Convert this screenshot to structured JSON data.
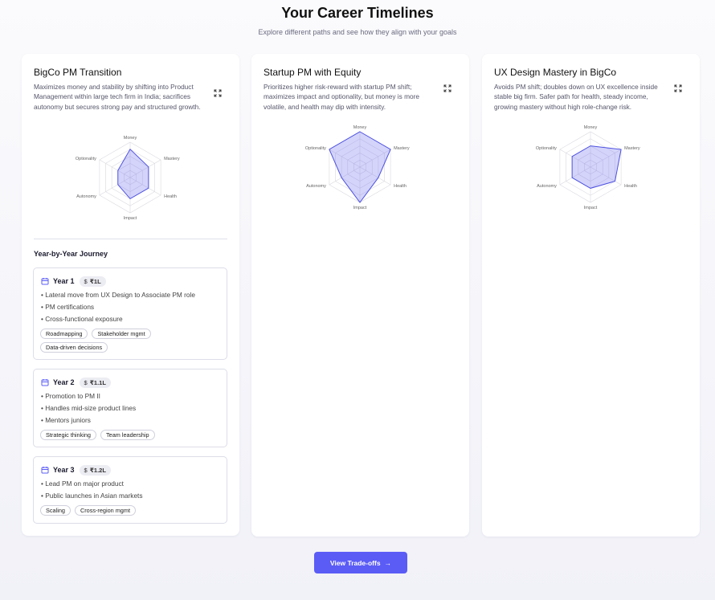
{
  "page": {
    "title": "Your Career Timelines",
    "subtitle": "Explore different paths and see how they align with your goals"
  },
  "radar_axes": [
    "Money",
    "Mastery",
    "Health",
    "Impact",
    "Autonomy",
    "Optionality"
  ],
  "radar_scale_max": 5,
  "colors": {
    "accent": "#5b5cf6",
    "radar_fill": "rgba(99,102,241,0.28)",
    "radar_stroke": "#4f52e0"
  },
  "timelines": [
    {
      "title": "BigCo PM Transition",
      "description": "Maximizes money and stability by shifting into Product Management within large tech firm in India; sacrifices autonomy but secures strong pay and structured growth.",
      "radar_values": [
        4,
        3,
        3,
        3,
        2,
        2
      ],
      "journey_heading": "Year-by-Year Journey",
      "years": [
        {
          "label": "Year 1",
          "salary": "₹1L",
          "items": [
            "Lateral move from UX Design to Associate PM role",
            "PM certifications",
            "Cross-functional exposure"
          ],
          "skills": [
            "Roadmapping",
            "Stakeholder mgmt",
            "Data-driven decisions"
          ]
        },
        {
          "label": "Year 2",
          "salary": "₹1.1L",
          "items": [
            "Promotion to PM II",
            "Handles mid-size product lines",
            "Mentors juniors"
          ],
          "skills": [
            "Strategic thinking",
            "Team leadership"
          ]
        },
        {
          "label": "Year 3",
          "salary": "₹1.2L",
          "items": [
            "Lead PM on major product",
            "Public launches in Asian markets"
          ],
          "skills": [
            "Scaling",
            "Cross-region mgmt"
          ]
        }
      ]
    },
    {
      "title": "Startup PM with Equity",
      "description": "Prioritizes higher risk-reward with startup PM shift; maximizes impact and optionality, but money is more volatile, and health may dip with intensity.",
      "radar_values": [
        5,
        5,
        3,
        5,
        3,
        5
      ]
    },
    {
      "title": "UX Design Mastery in BigCo",
      "description": "Avoids PM shift; doubles down on UX excellence inside stable big firm. Safer path for health, steady income, growing mastery without high role-change risk.",
      "radar_values": [
        3,
        5,
        4,
        3,
        3,
        3
      ]
    }
  ],
  "cta": {
    "label": "View Trade-offs",
    "arrow": "→"
  }
}
